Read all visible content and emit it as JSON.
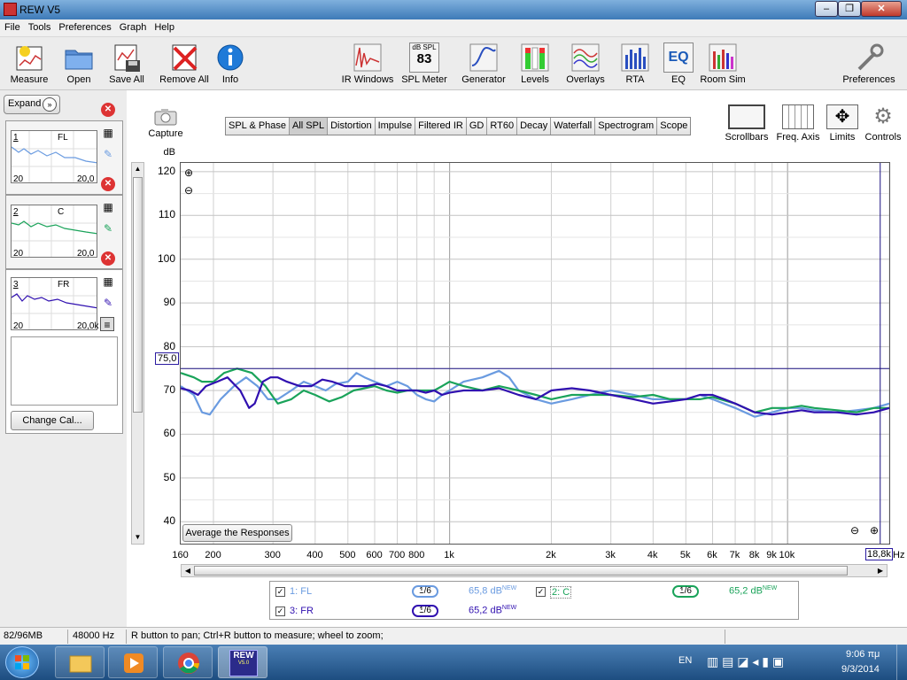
{
  "window": {
    "title": "REW V5"
  },
  "menu": [
    "File",
    "Tools",
    "Preferences",
    "Graph",
    "Help"
  ],
  "toolbar": {
    "measure": "Measure",
    "open": "Open",
    "save_all": "Save All",
    "remove_all": "Remove All",
    "info": "Info",
    "ir_windows": "IR Windows",
    "spl_meter": "SPL Meter",
    "spl_meter_caption": "dB SPL",
    "spl_meter_value": "83",
    "generator": "Generator",
    "levels": "Levels",
    "overlays": "Overlays",
    "rta": "RTA",
    "eq": "EQ",
    "eq_icon_text": "EQ",
    "room_sim": "Room Sim",
    "preferences": "Preferences"
  },
  "left_panel": {
    "expand": "Expand",
    "measurements": [
      {
        "num": "1",
        "name": "FL",
        "fmin": "20",
        "fmax": "20,0",
        "color": "#6a9be0"
      },
      {
        "num": "2",
        "name": "C",
        "fmin": "20",
        "fmax": "20,0",
        "color": "#1aa35a"
      },
      {
        "num": "3",
        "name": "FR",
        "fmin": "20",
        "fmax": "20,0k",
        "color": "#3010b0"
      }
    ],
    "change_cal": "Change Cal..."
  },
  "graph": {
    "capture": "Capture",
    "tabs": [
      "SPL & Phase",
      "All SPL",
      "Distortion",
      "Impulse",
      "Filtered IR",
      "GD",
      "RT60",
      "Decay",
      "Waterfall",
      "Spectrogram",
      "Scope"
    ],
    "active_tab": "All SPL",
    "tools": {
      "scrollbars": "Scrollbars",
      "freq_axis": "Freq. Axis",
      "limits": "Limits",
      "controls": "Controls"
    },
    "average_button": "Average the Responses",
    "cursor_value": "75,0",
    "cursor_freq": "18,8k",
    "x_unit": "Hz"
  },
  "chart_data": {
    "type": "line",
    "ylabel": "dB",
    "ylim": [
      35,
      122
    ],
    "xlim": [
      160,
      20000
    ],
    "xscale": "log",
    "grid": true,
    "yticks": [
      "120",
      "110",
      "100",
      "90",
      "80",
      "70",
      "60",
      "50",
      "40"
    ],
    "xticks": [
      "160",
      "200",
      "300",
      "400",
      "500",
      "600",
      "700",
      "800",
      "1k",
      "2k",
      "3k",
      "4k",
      "5k",
      "6k",
      "7k",
      "8k",
      "9k",
      "10k"
    ],
    "cursor_level": 75,
    "cursor_freq": 18800,
    "series": [
      {
        "name": "1: FL",
        "color": "#6a9be0",
        "points": [
          [
            160,
            71
          ],
          [
            175,
            69
          ],
          [
            185,
            65
          ],
          [
            195,
            64.5
          ],
          [
            210,
            68
          ],
          [
            230,
            71
          ],
          [
            250,
            73
          ],
          [
            270,
            71
          ],
          [
            290,
            68
          ],
          [
            310,
            68
          ],
          [
            340,
            70
          ],
          [
            370,
            72
          ],
          [
            400,
            71
          ],
          [
            430,
            70
          ],
          [
            460,
            71.5
          ],
          [
            500,
            72
          ],
          [
            530,
            74
          ],
          [
            560,
            73
          ],
          [
            600,
            72
          ],
          [
            650,
            71
          ],
          [
            700,
            72
          ],
          [
            750,
            71
          ],
          [
            800,
            69
          ],
          [
            850,
            68
          ],
          [
            900,
            67.5
          ],
          [
            950,
            69
          ],
          [
            1000,
            70
          ],
          [
            1100,
            72
          ],
          [
            1250,
            73
          ],
          [
            1400,
            74.5
          ],
          [
            1500,
            73
          ],
          [
            1600,
            70
          ],
          [
            1800,
            68
          ],
          [
            2000,
            67
          ],
          [
            2300,
            68
          ],
          [
            2600,
            69
          ],
          [
            3000,
            70
          ],
          [
            3500,
            69
          ],
          [
            4000,
            68
          ],
          [
            4500,
            68
          ],
          [
            5000,
            68
          ],
          [
            5500,
            69
          ],
          [
            6000,
            68
          ],
          [
            7000,
            66
          ],
          [
            8000,
            64
          ],
          [
            9000,
            65
          ],
          [
            10000,
            66
          ],
          [
            11000,
            66
          ],
          [
            12000,
            65.5
          ],
          [
            14000,
            65
          ],
          [
            16000,
            65.5
          ],
          [
            18000,
            66
          ],
          [
            20000,
            67
          ]
        ]
      },
      {
        "name": "2: C",
        "color": "#1aa35a",
        "points": [
          [
            160,
            74
          ],
          [
            175,
            73
          ],
          [
            185,
            72
          ],
          [
            200,
            72
          ],
          [
            215,
            74
          ],
          [
            235,
            75
          ],
          [
            260,
            74
          ],
          [
            285,
            71
          ],
          [
            310,
            67
          ],
          [
            340,
            68
          ],
          [
            370,
            70
          ],
          [
            400,
            69
          ],
          [
            440,
            67.5
          ],
          [
            480,
            68.5
          ],
          [
            520,
            70
          ],
          [
            560,
            70.5
          ],
          [
            600,
            71
          ],
          [
            650,
            70
          ],
          [
            700,
            69.5
          ],
          [
            750,
            70
          ],
          [
            800,
            70
          ],
          [
            850,
            70
          ],
          [
            900,
            70
          ],
          [
            950,
            71
          ],
          [
            1000,
            72
          ],
          [
            1100,
            71
          ],
          [
            1250,
            70
          ],
          [
            1400,
            71
          ],
          [
            1600,
            70
          ],
          [
            1800,
            69
          ],
          [
            2000,
            68
          ],
          [
            2300,
            69
          ],
          [
            2600,
            69
          ],
          [
            3000,
            69
          ],
          [
            3500,
            68.5
          ],
          [
            4000,
            69
          ],
          [
            4500,
            68
          ],
          [
            5000,
            68
          ],
          [
            5500,
            68
          ],
          [
            6000,
            68.5
          ],
          [
            7000,
            67
          ],
          [
            8000,
            65
          ],
          [
            9000,
            66
          ],
          [
            10000,
            66
          ],
          [
            11000,
            66.5
          ],
          [
            12000,
            66
          ],
          [
            14000,
            65.5
          ],
          [
            16000,
            65
          ],
          [
            18000,
            66
          ],
          [
            20000,
            66
          ]
        ]
      },
      {
        "name": "3: FR",
        "color": "#3010b0",
        "points": [
          [
            160,
            70.5
          ],
          [
            170,
            70
          ],
          [
            180,
            69
          ],
          [
            190,
            71
          ],
          [
            205,
            72
          ],
          [
            220,
            73
          ],
          [
            240,
            70
          ],
          [
            255,
            66
          ],
          [
            265,
            67
          ],
          [
            280,
            72
          ],
          [
            295,
            73
          ],
          [
            310,
            73
          ],
          [
            330,
            72
          ],
          [
            360,
            71
          ],
          [
            390,
            71
          ],
          [
            420,
            72.5
          ],
          [
            450,
            72
          ],
          [
            490,
            71
          ],
          [
            530,
            71
          ],
          [
            570,
            71
          ],
          [
            610,
            71.5
          ],
          [
            650,
            71
          ],
          [
            700,
            70
          ],
          [
            750,
            70
          ],
          [
            800,
            70
          ],
          [
            850,
            69.5
          ],
          [
            900,
            70
          ],
          [
            950,
            69
          ],
          [
            1000,
            69.5
          ],
          [
            1100,
            70
          ],
          [
            1250,
            70
          ],
          [
            1400,
            70.5
          ],
          [
            1600,
            69
          ],
          [
            1800,
            68
          ],
          [
            2000,
            70
          ],
          [
            2300,
            70.5
          ],
          [
            2600,
            70
          ],
          [
            3000,
            69
          ],
          [
            3500,
            68
          ],
          [
            4000,
            67
          ],
          [
            4500,
            67.5
          ],
          [
            5000,
            68
          ],
          [
            5500,
            69
          ],
          [
            6000,
            69
          ],
          [
            6500,
            68
          ],
          [
            7000,
            67
          ],
          [
            8000,
            65
          ],
          [
            9000,
            64.5
          ],
          [
            10000,
            65
          ],
          [
            11000,
            65.5
          ],
          [
            12000,
            65
          ],
          [
            14000,
            65
          ],
          [
            16000,
            64.5
          ],
          [
            18000,
            65
          ],
          [
            20000,
            66
          ]
        ]
      }
    ]
  },
  "legend": {
    "items": [
      {
        "label": "1: FL",
        "smoothing": "1/6",
        "value": "65,8 dB",
        "tag": "NEW",
        "color": "#6a9be0",
        "checked": true
      },
      {
        "label": "2: C",
        "smoothing": "1/6",
        "value": "65,2 dB",
        "tag": "NEW",
        "color": "#1aa35a",
        "checked": true
      },
      {
        "label": "3: FR",
        "smoothing": "1/6",
        "value": "65,2 dB",
        "tag": "NEW",
        "color": "#3010b0",
        "checked": true
      }
    ]
  },
  "status": {
    "memory": "82/96MB",
    "rate": "48000 Hz",
    "hint": "R button to pan; Ctrl+R button to measure; wheel to zoom;"
  },
  "taskbar": {
    "lang": "EN",
    "time": "9:06 πμ",
    "date": "9/3/2014",
    "rew_label": "REW",
    "rew_version": "V5.0"
  }
}
